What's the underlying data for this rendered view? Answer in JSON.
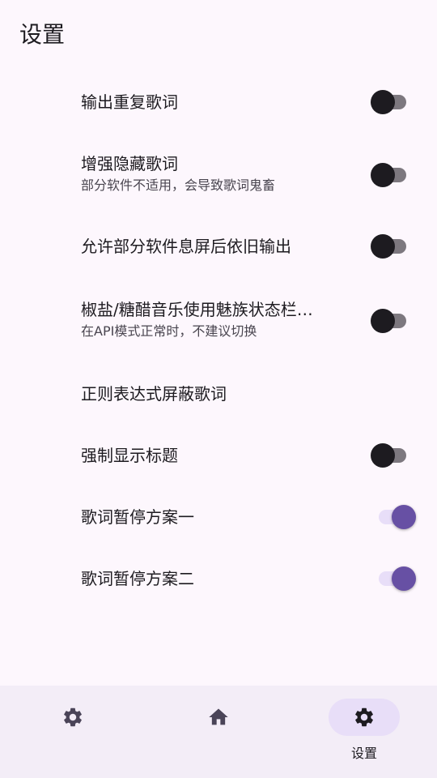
{
  "header": {
    "title": "设置"
  },
  "settings": [
    {
      "title": "输出重复歌词",
      "summary": "",
      "switch_on": false
    },
    {
      "title": "增强隐藏歌词",
      "summary": "部分软件不适用，会导致歌词鬼畜",
      "switch_on": false
    },
    {
      "title": "允许部分软件息屏后依旧输出",
      "summary": "",
      "switch_on": false
    },
    {
      "title": "椒盐/糖醋音乐使用魅族状态栏…",
      "summary": "在API模式正常时，不建议切换",
      "switch_on": false
    },
    {
      "title": "正则表达式屏蔽歌词",
      "summary": "",
      "switch_on": null
    },
    {
      "title": "强制显示标题",
      "summary": "",
      "switch_on": false
    },
    {
      "title": "歌词暂停方案一",
      "summary": "",
      "switch_on": true
    },
    {
      "title": "歌词暂停方案二",
      "summary": "",
      "switch_on": true
    }
  ],
  "bottom_nav": {
    "items": [
      {
        "icon": "gear-icon",
        "label": "",
        "active": false
      },
      {
        "icon": "home-icon",
        "label": "",
        "active": false
      },
      {
        "icon": "gear-icon",
        "label": "设置",
        "active": true
      }
    ]
  },
  "colors": {
    "background": "#fdf7fd",
    "accent": "#6750a4",
    "accent_track": "#e8def8",
    "nav_background": "#f3edf7"
  }
}
